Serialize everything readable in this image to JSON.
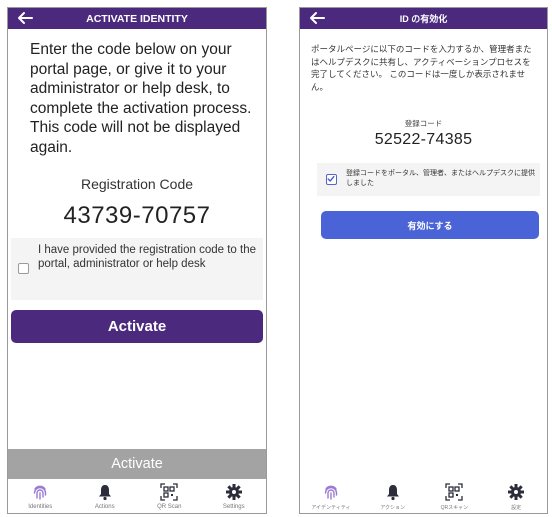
{
  "colors": {
    "header": "#4b2a7e",
    "primary": "#4b2a7e",
    "jp_primary": "#4a63d6",
    "disabled": "#a3a3a3",
    "identity_icon": "#9b7ad1"
  },
  "english": {
    "header_title": "ACTIVATE IDENTITY",
    "instructions": "Enter the code below on your portal page, or give it to your administrator or help desk, to complete the activation process. This code will not be displayed again.",
    "registration_label": "Registration Code",
    "registration_code": "43739-70757",
    "confirm_text": "I have provided the registration code to the portal, administrator or help desk",
    "confirm_checked": false,
    "activate_label": "Activate",
    "activate_bottom_label": "Activate",
    "nav": [
      {
        "label": "Identities",
        "icon": "fingerprint-icon"
      },
      {
        "label": "Actions",
        "icon": "bell-icon"
      },
      {
        "label": "QR Scan",
        "icon": "qr-scan-icon"
      },
      {
        "label": "Settings",
        "icon": "gear-icon"
      }
    ]
  },
  "japanese": {
    "header_title": "ID の有効化",
    "instructions": "ポータルページに以下のコードを入力するか、管理者またはヘルプデスクに共有し、アクティベーションプロセスを完了してください。 このコードは一度しか表示されません。",
    "registration_label": "登録コード",
    "registration_code": "52522-74385",
    "confirm_text": "登録コードをポータル、管理者、またはヘルプデスクに提供しました",
    "confirm_checked": true,
    "activate_label": "有効にする",
    "nav": [
      {
        "label": "アイデンティティ",
        "icon": "fingerprint-icon"
      },
      {
        "label": "アクション",
        "icon": "bell-icon"
      },
      {
        "label": "QRスキャン",
        "icon": "qr-scan-icon"
      },
      {
        "label": "設定",
        "icon": "gear-icon"
      }
    ]
  }
}
